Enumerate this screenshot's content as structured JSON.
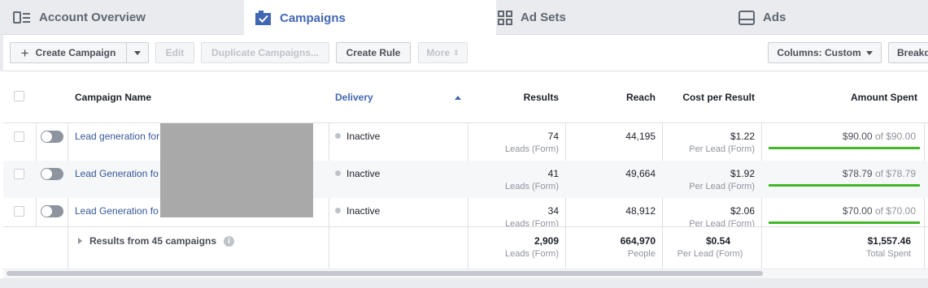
{
  "tabs": [
    {
      "label": "Account Overview",
      "icon": "account-overview-icon"
    },
    {
      "label": "Campaigns",
      "icon": "campaigns-checkbox-icon",
      "active": true
    },
    {
      "label": "Ad Sets",
      "icon": "ad-sets-grid-icon"
    },
    {
      "label": "Ads",
      "icon": "ads-icon"
    }
  ],
  "toolbar": {
    "create_campaign": "Create Campaign",
    "edit": "Edit",
    "duplicate": "Duplicate Campaigns...",
    "create_rule": "Create Rule",
    "more": "More",
    "columns": "Columns: Custom",
    "breakdown": "Breakdown"
  },
  "table": {
    "headers": {
      "campaign_name": "Campaign Name",
      "delivery": "Delivery",
      "results": "Results",
      "reach": "Reach",
      "cost_per_result": "Cost per Result",
      "amount_spent": "Amount Spent"
    },
    "rows": [
      {
        "name": "Lead generation for",
        "delivery": "Inactive",
        "results": "74",
        "results_sub": "Leads (Form)",
        "reach": "44,195",
        "cost": "$1.22",
        "cost_sub": "Per Lead (Form)",
        "spent": "$90.00",
        "of": "of",
        "budget": "$90.00",
        "progress": 1.0
      },
      {
        "name": "Lead Generation fo",
        "delivery": "Inactive",
        "results": "41",
        "results_sub": "Leads (Form)",
        "reach": "49,664",
        "cost": "$1.92",
        "cost_sub": "Per Lead (Form)",
        "spent": "$78.79",
        "of": "of",
        "budget": "$78.79",
        "progress": 1.0
      },
      {
        "name": "Lead Generation fo",
        "delivery": "Inactive",
        "results": "34",
        "results_sub": "Leads (Form)",
        "reach": "48,912",
        "cost": "$2.06",
        "cost_sub": "Per Lead (Form)",
        "spent": "$70.00",
        "of": "of",
        "budget": "$70.00",
        "progress": 1.0
      }
    ],
    "footer": {
      "label": "Results from 45 campaigns",
      "results": "2,909",
      "results_sub": "Leads (Form)",
      "reach": "664,970",
      "reach_sub": "People",
      "cost": "$0.54",
      "cost_sub": "Per Lead (Form)",
      "spent": "$1,557.46",
      "spent_sub": "Total Spent"
    }
  },
  "colors": {
    "link": "#365899",
    "active_tab": "#4267b2",
    "progress": "#42b72a",
    "inactive_dot": "#bec3c9"
  }
}
